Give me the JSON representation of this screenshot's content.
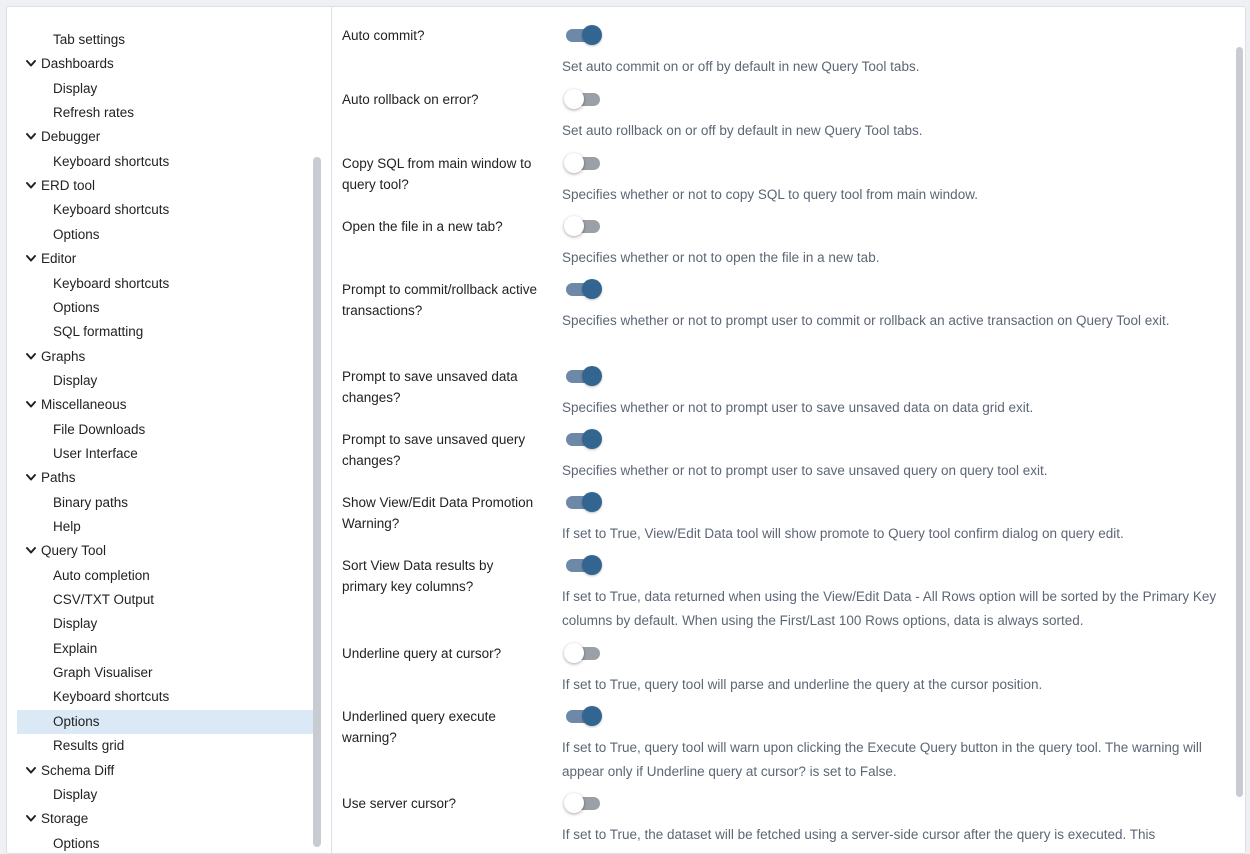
{
  "sidebar": {
    "items": [
      {
        "type": "child",
        "label": "Tab settings"
      },
      {
        "type": "parent",
        "label": "Dashboards"
      },
      {
        "type": "child",
        "label": "Display"
      },
      {
        "type": "child",
        "label": "Refresh rates"
      },
      {
        "type": "parent",
        "label": "Debugger"
      },
      {
        "type": "child",
        "label": "Keyboard shortcuts"
      },
      {
        "type": "parent",
        "label": "ERD tool"
      },
      {
        "type": "child",
        "label": "Keyboard shortcuts"
      },
      {
        "type": "child",
        "label": "Options"
      },
      {
        "type": "parent",
        "label": "Editor"
      },
      {
        "type": "child",
        "label": "Keyboard shortcuts"
      },
      {
        "type": "child",
        "label": "Options"
      },
      {
        "type": "child",
        "label": "SQL formatting"
      },
      {
        "type": "parent",
        "label": "Graphs"
      },
      {
        "type": "child",
        "label": "Display"
      },
      {
        "type": "parent",
        "label": "Miscellaneous"
      },
      {
        "type": "child",
        "label": "File Downloads"
      },
      {
        "type": "child",
        "label": "User Interface"
      },
      {
        "type": "parent",
        "label": "Paths"
      },
      {
        "type": "child",
        "label": "Binary paths"
      },
      {
        "type": "child",
        "label": "Help"
      },
      {
        "type": "parent",
        "label": "Query Tool"
      },
      {
        "type": "child",
        "label": "Auto completion"
      },
      {
        "type": "child",
        "label": "CSV/TXT Output"
      },
      {
        "type": "child",
        "label": "Display"
      },
      {
        "type": "child",
        "label": "Explain"
      },
      {
        "type": "child",
        "label": "Graph Visualiser"
      },
      {
        "type": "child",
        "label": "Keyboard shortcuts"
      },
      {
        "type": "child",
        "label": "Options",
        "selected": true
      },
      {
        "type": "child",
        "label": "Results grid"
      },
      {
        "type": "parent",
        "label": "Schema Diff"
      },
      {
        "type": "child",
        "label": "Display"
      },
      {
        "type": "parent",
        "label": "Storage"
      },
      {
        "type": "child",
        "label": "Options"
      }
    ],
    "expand_icon": "chevron-down-icon"
  },
  "settings": [
    {
      "label": "Auto commit?",
      "on": true,
      "help": "Set auto commit on or off by default in new Query Tool tabs."
    },
    {
      "label": "Auto rollback on error?",
      "on": false,
      "help": "Set auto rollback on or off by default in new Query Tool tabs."
    },
    {
      "label": "Copy SQL from main window to query tool?",
      "on": false,
      "help": "Specifies whether or not to copy SQL to query tool from main window."
    },
    {
      "label": "Open the file in a new tab?",
      "on": false,
      "help": "Specifies whether or not to open the file in a new tab."
    },
    {
      "label": "Prompt to commit/rollback active transactions?",
      "on": true,
      "help": "Specifies whether or not to prompt user to commit or rollback an active transaction on Query Tool exit."
    },
    {
      "label": "Prompt to save unsaved data changes?",
      "on": true,
      "help": "Specifies whether or not to prompt user to save unsaved data on data grid exit."
    },
    {
      "label": "Prompt to save unsaved query changes?",
      "on": true,
      "help": "Specifies whether or not to prompt user to save unsaved query on query tool exit."
    },
    {
      "label": "Show View/Edit Data Promotion Warning?",
      "on": true,
      "help": "If set to True, View/Edit Data tool will show promote to Query tool confirm dialog on query edit."
    },
    {
      "label": "Sort View Data results by primary key columns?",
      "on": true,
      "help": "If set to True, data returned when using the View/Edit Data - All Rows option will be sorted by the Primary Key columns by default. When using the First/Last 100 Rows options, data is always sorted."
    },
    {
      "label": "Underline query at cursor?",
      "on": false,
      "help": "If set to True, query tool will parse and underline the query at the cursor position."
    },
    {
      "label": "Underlined query execute warning?",
      "on": true,
      "help": "If set to True, query tool will warn upon clicking the Execute Query button in the query tool. The warning will appear only if Underline query at cursor? is set to False."
    },
    {
      "label": "Use server cursor?",
      "on": false,
      "help": "If set to True, the dataset will be fetched using a server-side cursor after the query is executed. This"
    }
  ],
  "colors": {
    "toggle_on_knob": "#326690",
    "toggle_on_track": "#6e89a8",
    "toggle_off_track": "#9aa0a6",
    "selected_row": "#dbe9f7",
    "help_text": "#5d6675"
  }
}
